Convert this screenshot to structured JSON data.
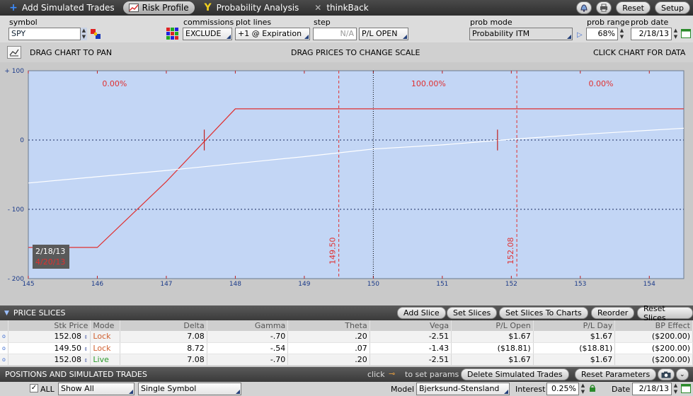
{
  "tabs": [
    {
      "label": "Add Simulated Trades",
      "icon": "plus-icon"
    },
    {
      "label": "Risk Profile",
      "icon": "chart-icon"
    },
    {
      "label": "Probability Analysis",
      "icon": "y-icon"
    },
    {
      "label": "thinkBack",
      "icon": "wrench-icon"
    }
  ],
  "toolbar": {
    "reset_label": "Reset",
    "setup_label": "Setup"
  },
  "controls": {
    "symbol_label": "symbol",
    "symbol_value": "SPY",
    "commissions_label": "commissions",
    "commissions_value": "EXCLUDE",
    "plot_lines_label": "plot lines",
    "plot_lines_value": "+1 @ Expiration",
    "step_label": "step",
    "step_value": "N/A",
    "pl_value": "P/L OPEN",
    "prob_mode_label": "prob mode",
    "prob_mode_value": "Probability ITM",
    "prob_range_label": "prob range",
    "prob_range_value": "68%",
    "prob_date_label": "prob date",
    "prob_date_value": "2/18/13"
  },
  "hints": {
    "drag_chart": "DRAG CHART TO PAN",
    "drag_prices": "DRAG PRICES TO CHANGE SCALE",
    "click_chart": "CLICK CHART FOR DATA"
  },
  "chart_data": {
    "type": "line",
    "xlim": [
      145,
      154.5
    ],
    "ylim": [
      -200,
      100
    ],
    "x_ticks": [
      "145",
      "146",
      "147",
      "148",
      "149",
      "150",
      "151",
      "152",
      "153",
      "154"
    ],
    "y_ticks": [
      "+ 100",
      "0",
      "- 100",
      "- 200"
    ],
    "grid": true,
    "series": [
      {
        "color": "#e03030",
        "x": [
          145.0,
          146.0,
          147.0,
          148.0,
          149.0,
          150.0,
          151.0,
          152.0,
          153.0,
          154.5
        ],
        "y": [
          -155,
          -155,
          -60,
          45,
          45,
          45,
          45,
          45,
          45,
          45
        ]
      },
      {
        "color": "#ffffff",
        "x": [
          145.0,
          146.0,
          147.0,
          148.0,
          149.0,
          150.0,
          151.0,
          152.0,
          153.0,
          154.5
        ],
        "y": [
          -62,
          -53,
          -44,
          -34,
          -24,
          -13,
          -7,
          1,
          8,
          17
        ]
      }
    ],
    "vlines": [
      {
        "x": 149.5,
        "label": "149.50",
        "color": "#e03030"
      },
      {
        "x": 152.08,
        "label": "152.08",
        "color": "#e03030"
      },
      {
        "x": 150.0,
        "color": "#000000"
      }
    ],
    "zone_labels": [
      {
        "x": 146.25,
        "text": "0.00%"
      },
      {
        "x": 150.8,
        "text": "100.00%"
      },
      {
        "x": 153.3,
        "text": "0.00%"
      }
    ],
    "date_box": {
      "date1": "2/18/13",
      "date2": "4/20/13"
    },
    "colors": {
      "bg": "#c3d6f5",
      "pl_expiration": "#e03030",
      "pl_today": "#ffffff"
    }
  },
  "price_slices": {
    "title": "PRICE SLICES",
    "buttons": [
      "Add Slice",
      "Set Slices",
      "Set Slices To Charts",
      "Reorder",
      "Reset Slices"
    ],
    "columns": [
      "Stk Price",
      "Mode",
      "Delta",
      "Gamma",
      "Theta",
      "Vega",
      "P/L Open",
      "P/L Day",
      "BP Effect"
    ],
    "rows": [
      [
        "152.08",
        "Lock",
        "7.08",
        "-.70",
        ".20",
        "-2.51",
        "$1.67",
        "$1.67",
        "($200.00)"
      ],
      [
        "149.50",
        "Lock",
        "8.72",
        "-.54",
        ".07",
        "-1.43",
        "($18.81)",
        "($18.81)",
        "($200.00)"
      ],
      [
        "152.08",
        "Live",
        "7.08",
        "-.70",
        ".20",
        "-2.51",
        "$1.67",
        "$1.67",
        "($200.00)"
      ]
    ]
  },
  "positions": {
    "title": "POSITIONS AND SIMULATED TRADES",
    "click_prefix": "click",
    "click_suffix": "to set params",
    "delete_label": "Delete Simulated Trades",
    "reset_params_label": "Reset Parameters"
  },
  "bottom": {
    "all_label": "ALL",
    "show_all_value": "Show All",
    "single_symbol_value": "Single Symbol",
    "model_label": "Model",
    "model_value": "Bjerksund-Stensland",
    "interest_label": "Interest",
    "interest_value": "0.25%",
    "date_label": "Date",
    "date_value": "2/18/13"
  }
}
